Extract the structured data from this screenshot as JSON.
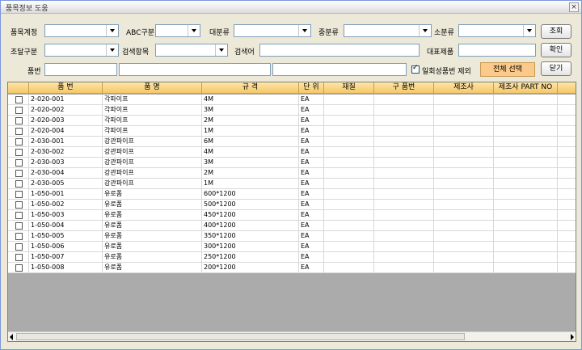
{
  "window": {
    "title": "품목정보 도움",
    "close_label": "×"
  },
  "filters": {
    "item_account_label": "품목계정",
    "abc_label": "ABC구분",
    "major_label": "대분류",
    "middle_label": "중분류",
    "minor_label": "소분류",
    "procure_label": "조달구분",
    "search_field_label": "검색항목",
    "search_word_label": "검색어",
    "rep_item_label": "대표제품",
    "item_no_label": "품번",
    "exclude_label": "일회성품번 제외",
    "exclude_checked": true
  },
  "buttons": {
    "search": "조회",
    "confirm": "확인",
    "close": "닫기",
    "select_all": "전체 선택"
  },
  "table": {
    "columns": [
      "품 번",
      "품 명",
      "규 격",
      "단 위",
      "재질",
      "구 품번",
      "제조사",
      "제조사 PART NO"
    ],
    "rows": [
      [
        "2-020-001",
        "각파이프",
        "4M",
        "EA",
        "",
        "",
        "",
        ""
      ],
      [
        "2-020-002",
        "각파이프",
        "3M",
        "EA",
        "",
        "",
        "",
        ""
      ],
      [
        "2-020-003",
        "각파이프",
        "2M",
        "EA",
        "",
        "",
        "",
        ""
      ],
      [
        "2-020-004",
        "각파이프",
        "1M",
        "EA",
        "",
        "",
        "",
        ""
      ],
      [
        "2-030-001",
        "강관파이프",
        "6M",
        "EA",
        "",
        "",
        "",
        ""
      ],
      [
        "2-030-002",
        "강관파이프",
        "4M",
        "EA",
        "",
        "",
        "",
        ""
      ],
      [
        "2-030-003",
        "강관파이프",
        "3M",
        "EA",
        "",
        "",
        "",
        ""
      ],
      [
        "2-030-004",
        "강관파이프",
        "2M",
        "EA",
        "",
        "",
        "",
        ""
      ],
      [
        "2-030-005",
        "강관파이프",
        "1M",
        "EA",
        "",
        "",
        "",
        ""
      ],
      [
        "1-050-001",
        "유로폼",
        "600*1200",
        "EA",
        "",
        "",
        "",
        ""
      ],
      [
        "1-050-002",
        "유로폼",
        "500*1200",
        "EA",
        "",
        "",
        "",
        ""
      ],
      [
        "1-050-003",
        "유로폼",
        "450*1200",
        "EA",
        "",
        "",
        "",
        ""
      ],
      [
        "1-050-004",
        "유로폼",
        "400*1200",
        "EA",
        "",
        "",
        "",
        ""
      ],
      [
        "1-050-005",
        "유로폼",
        "350*1200",
        "EA",
        "",
        "",
        "",
        ""
      ],
      [
        "1-050-006",
        "유로폼",
        "300*1200",
        "EA",
        "",
        "",
        "",
        ""
      ],
      [
        "1-050-007",
        "유로폼",
        "250*1200",
        "EA",
        "",
        "",
        "",
        ""
      ],
      [
        "1-050-008",
        "유로폼",
        "200*1200",
        "EA",
        "",
        "",
        "",
        ""
      ]
    ]
  }
}
